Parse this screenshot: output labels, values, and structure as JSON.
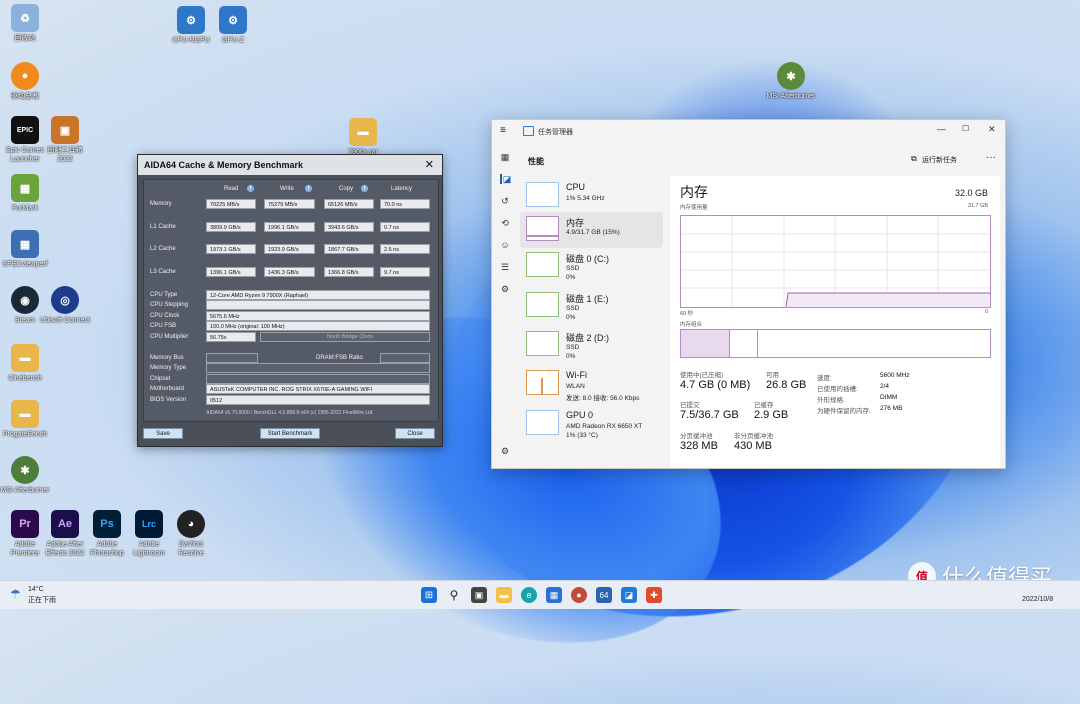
{
  "desktop": {
    "icons": [
      {
        "label": "回收站",
        "color": "#7aa6d6",
        "glyph": "♻"
      },
      {
        "label": "CPU-RGPU",
        "color": "#2f77c8",
        "glyph": "⚙"
      },
      {
        "label": "GPU-Z",
        "color": "#2f77c8",
        "glyph": "⚙"
      },
      {
        "label": "驱动总裁",
        "color": "#f08a1c",
        "glyph": "●"
      },
      {
        "label": "MSI Afterburner",
        "color": "#5a8a3a",
        "glyph": "✱"
      },
      {
        "label": "Epic Games Launcher",
        "color": "#111111",
        "glyph": "EPIC"
      },
      {
        "label": "图吧工具箱 2022",
        "color": "#c8742b",
        "glyph": "▣"
      },
      {
        "label": "7900x.rar",
        "color": "#e8b64a",
        "glyph": "▬"
      },
      {
        "label": "FurMark",
        "color": "#6aa33a",
        "glyph": "▦"
      },
      {
        "label": "SPECviewperf",
        "color": "#3c6fb4",
        "glyph": "▦"
      },
      {
        "label": "Steam",
        "color": "#1b2838",
        "glyph": "◉"
      },
      {
        "label": "Ubisoft Connect",
        "color": "#1d3c8c",
        "glyph": "◎"
      },
      {
        "label": "Cinebench",
        "color": "#e8b64a",
        "glyph": "▬"
      },
      {
        "label": "ProgateBench",
        "color": "#e8b64a",
        "glyph": "▬"
      },
      {
        "label": "MSI Afterburner",
        "color": "#4d7f38",
        "glyph": "✱"
      },
      {
        "label": "Adobe Premiere",
        "color": "#2a0a4a",
        "glyph": "Pr"
      },
      {
        "label": "Adobe After Effects 2022",
        "color": "#1a0f4a",
        "glyph": "Ae"
      },
      {
        "label": "Adobe Photoshop",
        "color": "#001e36",
        "glyph": "Ps"
      },
      {
        "label": "Adobe Lightroom",
        "color": "#001a33",
        "glyph": "Lrc"
      },
      {
        "label": "DaVinci Resolve",
        "color": "#222222",
        "glyph": "◕"
      }
    ]
  },
  "aida": {
    "title": "AIDA64 Cache & Memory Benchmark",
    "close_glyph": "✕",
    "columns": {
      "read": "Read",
      "write": "Write",
      "copy": "Copy",
      "latency": "Latency"
    },
    "rows": [
      {
        "label": "Memory",
        "read": "70225 MB/s",
        "write": "75279 MB/s",
        "copy": "65126 MB/s",
        "latency": "70.0 ns"
      },
      {
        "label": "L1 Cache",
        "read": "3809.9 GB/s",
        "write": "1996.1 GB/s",
        "copy": "3943.6 GB/s",
        "latency": "0.7 ns"
      },
      {
        "label": "L2 Cache",
        "read": "1973.1 GB/s",
        "write": "1923.9 GB/s",
        "copy": "1867.7 GB/s",
        "latency": "2.6 ns"
      },
      {
        "label": "L3 Cache",
        "read": "1396.1 GB/s",
        "write": "1436.3 GB/s",
        "copy": "1366.8 GB/s",
        "latency": "9.7 ns"
      }
    ],
    "info": {
      "cpu_type_label": "CPU Type",
      "cpu_type": "12-Core AMD Ryzen 9 7900X  (Raphael)",
      "cpu_stepping_label": "CPU Stepping",
      "cpu_clock_label": "CPU Clock",
      "cpu_clock": "5675.6 MHz",
      "cpu_fsb_label": "CPU FSB",
      "cpu_fsb": "100.0 MHz  (original: 100 MHz)",
      "cpu_mult_label": "CPU Multiplier",
      "cpu_mult": "56.75x",
      "nb_clock_label": "North Bridge Clock",
      "mem_bus_label": "Memory Bus",
      "dram_fsb_label": "DRAM:FSB Ratio",
      "mem_type_label": "Memory Type",
      "chipset_label": "Chipset",
      "motherboard_label": "Motherboard",
      "motherboard": "ASUSTeK COMPUTER INC. ROG STRIX X670E-A GAMING WIFI",
      "bios_label": "BIOS Version",
      "bios": "0512"
    },
    "footer": "AIDA64 v6.70.6000 / BenchDLL 4.5.868.8-x64  (c) 1995-2022 FinalWire Ltd.",
    "buttons": {
      "save": "Save",
      "start": "Start Benchmark",
      "close": "Close"
    }
  },
  "taskmgr": {
    "title": "任务管理器",
    "header": "性能",
    "run_task": "运行新任务",
    "more": "···",
    "items": [
      {
        "name": "CPU",
        "line1": "1% 5.34 GHz",
        "line2": "",
        "line3": ""
      },
      {
        "name": "内存",
        "line1": "4.9/31.7 GB (15%)",
        "line2": "",
        "line3": ""
      },
      {
        "name": "磁盘 0 (C:)",
        "line1": "SSD",
        "line2": "0%",
        "line3": ""
      },
      {
        "name": "磁盘 1 (E:)",
        "line1": "SSD",
        "line2": "0%",
        "line3": ""
      },
      {
        "name": "磁盘 2 (D:)",
        "line1": "SSD",
        "line2": "0%",
        "line3": ""
      },
      {
        "name": "Wi-Fi",
        "line1": "WLAN",
        "line2": "发送: 8.0  接收: 56.0 Kbps",
        "line3": ""
      },
      {
        "name": "GPU 0",
        "line1": "AMD Radeon RX 6650 XT",
        "line2": "1% (33 °C)",
        "line3": ""
      }
    ],
    "memory": {
      "title": "内存",
      "total": "32.0 GB",
      "usage_label": "内存使用量",
      "usage_max": "31.7 GB",
      "time_left": "60 秒",
      "time_right": "0",
      "composition_label": "内存组合",
      "used_label": "使用中(已压缩)",
      "used_value": "4.7 GB (0 MB)",
      "avail_label": "可用",
      "avail_value": "26.8 GB",
      "committed_label": "已提交",
      "committed_value": "7.5/36.7 GB",
      "cached_label": "已缓存",
      "cached_value": "2.9 GB",
      "paged_label": "分页缓冲池",
      "paged_value": "328 MB",
      "nonpaged_label": "非分页缓冲池",
      "nonpaged_value": "430 MB",
      "speed_label": "速度:",
      "speed_value": "5600 MHz",
      "slots_label": "已使用的插槽:",
      "slots_value": "2/4",
      "form_label": "外形规格:",
      "form_value": "DIMM",
      "reserved_label": "为硬件保留的内存:",
      "reserved_value": "276 MB",
      "usage_fraction": 0.15
    }
  },
  "taskbar": {
    "temp": "14°C",
    "weather": "正在下雨",
    "date": "2022/10/8",
    "watermark": "什么值得买",
    "watermark_logo": "值"
  },
  "colors": {
    "mem_accent": "#b58bc4",
    "cpu_accent": "#2a8fd8",
    "disk_accent": "#6aae4a"
  }
}
